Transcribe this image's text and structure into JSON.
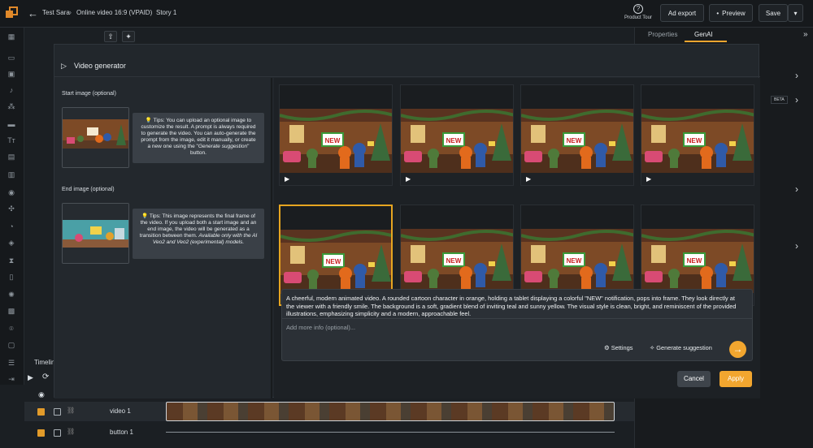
{
  "topbar": {
    "crumbs": [
      "Test Sara",
      "Online video 16:9 (VPAID)",
      "Story 1"
    ],
    "product_tour": "Product Tour",
    "ad_export": "Ad export",
    "preview": "Preview",
    "save": "Save"
  },
  "right_panel": {
    "tabs": [
      "Properties",
      "GenAI"
    ],
    "beta": "BETA"
  },
  "timeline": {
    "title": "Timeline",
    "rows": [
      "video 1",
      "button 1"
    ]
  },
  "modal": {
    "title": "Video generator",
    "start_label": "Start image (optional)",
    "start_tip_a": "Tips: You can upload an optional image to customize the result. A prompt is always required to generate the video. You can auto-generate the prompt from the image, edit it manually, or create a new one using the \"",
    "start_tip_em": "Generate suggestion",
    "start_tip_b": "\" button.",
    "end_label": "End image (optional)",
    "end_tip_a": "Tips: This image represents the final frame of the video. If you upload both a start image and an end image, the video will be generated as a transition between them. ",
    "end_tip_em": "Available only with the AI Veo2 and Veo2 (experimental) models.",
    "prompt": "A cheerful, modern animated video. A rounded cartoon character in orange, holding a tablet displaying a colorful \"NEW\" notification, pops into frame. They look directly at the viewer with a friendly smile. The background is a soft, gradient blend of inviting teal and sunny yellow. The visual style is clean, bright, and reminiscent of the provided illustrations, emphasizing simplicity and a modern, approachable feel.",
    "more_info_placeholder": "Add more info (optional)...",
    "settings": "Settings",
    "generate_suggestion": "Generate suggestion",
    "cancel": "Cancel",
    "apply": "Apply",
    "thumb_sign": "NEW"
  },
  "colors": {
    "accent": "#f2a62f",
    "selected_border": "#e6a520"
  }
}
